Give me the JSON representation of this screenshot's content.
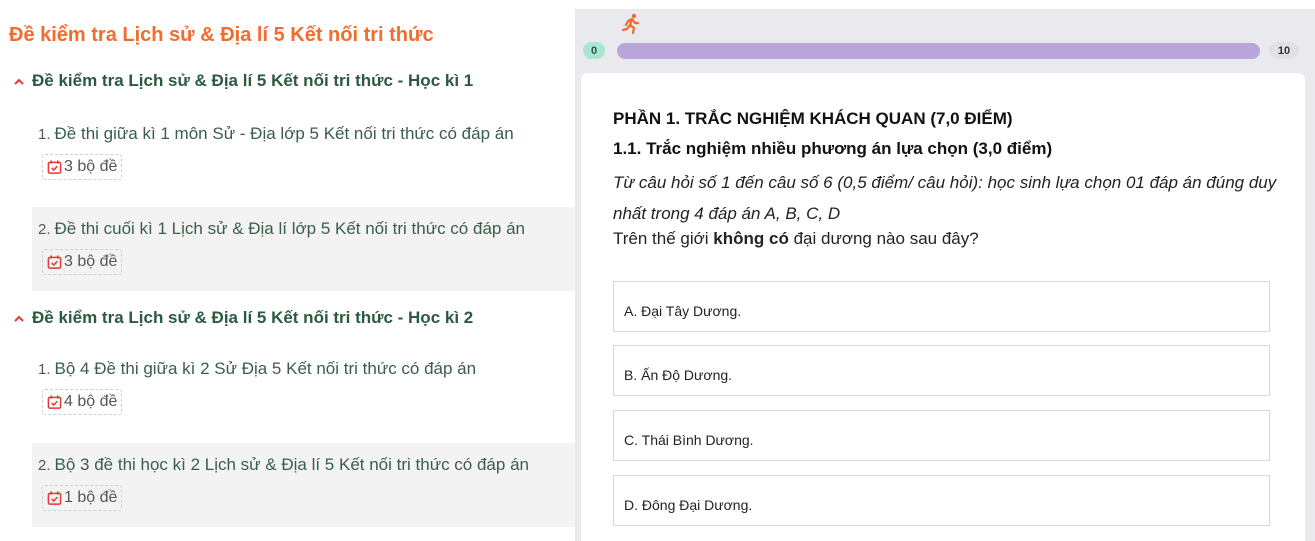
{
  "left": {
    "title": "Đề kiểm tra Lịch sử & Địa lí 5 Kết nối tri thức",
    "sections": [
      {
        "heading": "Đề kiểm tra Lịch sử & Địa lí 5 Kết nối tri thức - Học kì 1",
        "items": [
          {
            "num": "1.",
            "label": "Đề thi giữa kì 1 môn Sử - Địa lớp 5 Kết nối tri thức có đáp án",
            "badge": "3 bộ đề"
          },
          {
            "num": "2.",
            "label": "Đề thi cuối kì 1 Lịch sử & Địa lí lớp 5 Kết nối tri thức có đáp án",
            "badge": "3 bộ đề"
          }
        ]
      },
      {
        "heading": "Đề kiểm tra Lịch sử & Địa lí 5 Kết nối tri thức - Học kì 2",
        "items": [
          {
            "num": "1.",
            "label": "Bộ 4 Đề thi giữa kì 2 Sử Địa 5 Kết nối tri thức có đáp án",
            "badge": "4 bộ đề"
          },
          {
            "num": "2.",
            "label": "Bộ 3 đề thi học kì 2 Lịch sử & Địa lí 5 Kết nối tri thức có đáp án",
            "badge": "1 bộ đề"
          }
        ]
      }
    ]
  },
  "quiz": {
    "progress": {
      "start_label": "0",
      "end_label": "10",
      "current": 0
    },
    "part_title": "PHẦN 1. TRẮC NGHIỆM KHÁCH QUAN (7,0 ĐIỂM)",
    "sub_title": "1.1. Trắc nghiệm nhiều phương án lựa chọn (3,0 điểm)",
    "instruction": "Từ câu hỏi số 1 đến câu số 6 (0,5 điểm/ câu hỏi): học sinh lựa chọn 01 đáp án đúng duy nhất trong 4 đáp án A, B, C, D",
    "question_prefix": "Trên thế giới ",
    "question_bold": "không có",
    "question_suffix": " đại dương nào sau đây?",
    "options": [
      "A. Đại Tây Dương.",
      "B. Ấn Độ Dương.",
      "C. Thái Bình Dương.",
      "D. Đông Đại Dương."
    ]
  },
  "colors": {
    "title_orange": "#f26d2d",
    "heading_green": "#2b5a3e",
    "progress_purple": "#b9a5da",
    "badge_icon_red": "#e53935"
  },
  "icons": {
    "chevron": "chevron-up-icon",
    "calendar": "calendar-check-icon",
    "runner": "runner-icon"
  }
}
